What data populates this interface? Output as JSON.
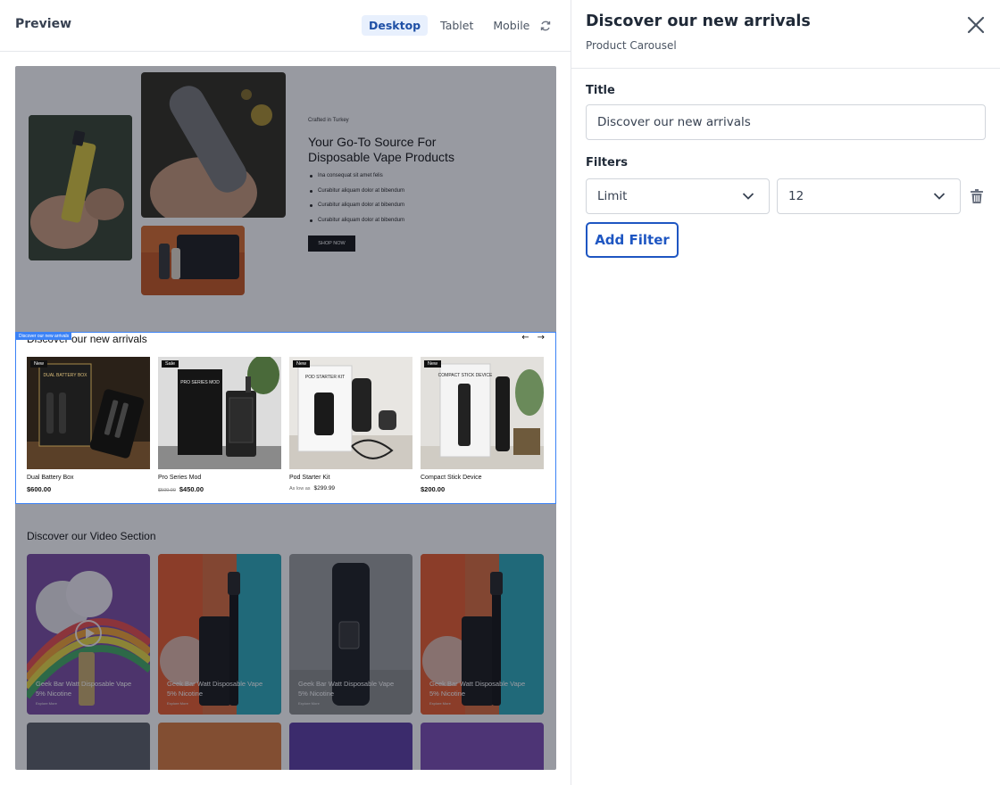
{
  "preview": {
    "title": "Preview",
    "devices": [
      "Desktop",
      "Tablet",
      "Mobile"
    ],
    "active_device": "Desktop",
    "refresh_icon": "refresh-icon"
  },
  "hero": {
    "kicker": "Crafted in Turkey",
    "title": "Your Go-To Source For Disposable Vape Products",
    "bullets": [
      "Ina consequat sit amet felis",
      "Curabitur aliquam dolor at bibendum",
      "Curabitur aliquam dolor at bibendum",
      "Curabitur aliquam dolor at bibendum"
    ],
    "button": "SHOP NOW"
  },
  "carousel": {
    "selected_tag": "Discover our new arrivals",
    "title": "Discover our new arrivals",
    "prev_arrow": "←",
    "next_arrow": "→",
    "products": [
      {
        "badge": "New",
        "name": "Dual Battery Box",
        "price": "$600.00",
        "old_price": "",
        "prefix": "",
        "box_text": "DUAL BATTERY BOX"
      },
      {
        "badge": "Sale",
        "name": "Pro Series Mod",
        "price": "$450.00",
        "old_price": "$500.00",
        "prefix": "",
        "box_text": "PRO SERIES MOD"
      },
      {
        "badge": "New",
        "name": "Pod Starter Kit",
        "price": "$299.99",
        "old_price": "",
        "prefix": "As low as",
        "box_text": "POD STARTER KIT"
      },
      {
        "badge": "New",
        "name": "Compact Stick Device",
        "price": "$200.00",
        "old_price": "",
        "prefix": "",
        "box_text": "COMPACT STICK DEVICE"
      }
    ]
  },
  "video_section": {
    "title": "Discover our Video Section",
    "cards": [
      {
        "line1": "Geek Bar Watt Disposable Vape",
        "line2": "5% Nicotine",
        "sub": "Explore More"
      },
      {
        "line1": "Geek Bar Watt Disposable Vape",
        "line2": "5% Nicotine",
        "sub": "Explore More"
      },
      {
        "line1": "Geek Bar Watt Disposable Vape",
        "line2": "5% Nicotine",
        "sub": "Explore More"
      },
      {
        "line1": "Geek Bar Watt Disposable Vape",
        "line2": "5% Nicotine",
        "sub": "Explore More"
      }
    ]
  },
  "panel": {
    "title": "Discover our new arrivals",
    "subtitle": "Product Carousel",
    "title_label": "Title",
    "title_value": "Discover our new arrivals",
    "filters_label": "Filters",
    "filter_type": "Limit",
    "filter_value": "12",
    "add_filter": "Add Filter"
  },
  "colors": {
    "accent": "#1e56c2",
    "selection": "#3b82f6",
    "active_tab_bg": "#e8f0fd"
  }
}
